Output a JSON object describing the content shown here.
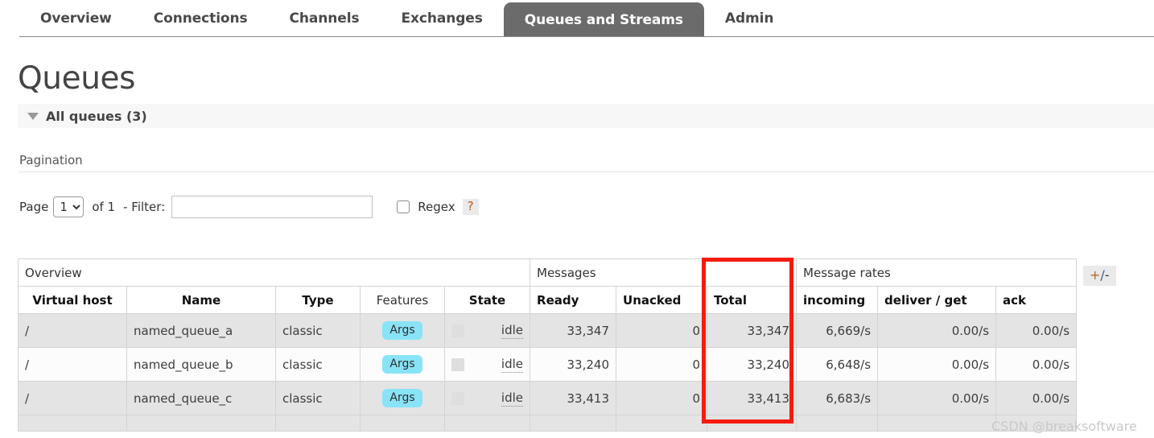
{
  "nav": {
    "items": [
      {
        "label": "Overview",
        "active": false
      },
      {
        "label": "Connections",
        "active": false
      },
      {
        "label": "Channels",
        "active": false
      },
      {
        "label": "Exchanges",
        "active": false
      },
      {
        "label": "Queues and Streams",
        "active": true
      },
      {
        "label": "Admin",
        "active": false
      }
    ]
  },
  "page": {
    "title": "Queues",
    "section_title": "All queues (3)"
  },
  "pagination": {
    "heading": "Pagination",
    "page_label": "Page",
    "page_value": "1",
    "page_options": [
      "1"
    ],
    "of_label": "of 1",
    "filter_label": "- Filter:",
    "filter_value": "",
    "filter_placeholder": "",
    "regex_label": "Regex",
    "regex_checked": false,
    "help_label": "?"
  },
  "table": {
    "group_headers": {
      "overview": "Overview",
      "messages": "Messages",
      "message_rates": "Message rates"
    },
    "columns": [
      {
        "key": "vhost",
        "label": "Virtual host",
        "bold": true
      },
      {
        "key": "name",
        "label": "Name",
        "bold": true
      },
      {
        "key": "type",
        "label": "Type",
        "bold": true
      },
      {
        "key": "features",
        "label": "Features",
        "bold": false
      },
      {
        "key": "state",
        "label": "State",
        "bold": true
      },
      {
        "key": "ready",
        "label": "Ready",
        "bold": true
      },
      {
        "key": "unacked",
        "label": "Unacked",
        "bold": true
      },
      {
        "key": "total",
        "label": "Total",
        "bold": true
      },
      {
        "key": "incoming",
        "label": "incoming",
        "bold": true
      },
      {
        "key": "deliver_get",
        "label": "deliver / get",
        "bold": true
      },
      {
        "key": "ack",
        "label": "ack",
        "bold": true
      }
    ],
    "rows": [
      {
        "vhost": "/",
        "name": "named_queue_a",
        "type": "classic",
        "features": "Args",
        "state": "idle",
        "ready": "33,347",
        "unacked": "0",
        "total": "33,347",
        "incoming": "6,669/s",
        "deliver_get": "0.00/s",
        "ack": "0.00/s"
      },
      {
        "vhost": "/",
        "name": "named_queue_b",
        "type": "classic",
        "features": "Args",
        "state": "idle",
        "ready": "33,240",
        "unacked": "0",
        "total": "33,240",
        "incoming": "6,648/s",
        "deliver_get": "0.00/s",
        "ack": "0.00/s"
      },
      {
        "vhost": "/",
        "name": "named_queue_c",
        "type": "classic",
        "features": "Args",
        "state": "idle",
        "ready": "33,413",
        "unacked": "0",
        "total": "33,413",
        "incoming": "6,683/s",
        "deliver_get": "0.00/s",
        "ack": "0.00/s"
      }
    ],
    "toggle_columns_label": "+/-"
  },
  "annotation": {
    "highlight_color": "#f51b0e",
    "highlights_column": "Total"
  },
  "watermark": "CSDN @breaksoftware"
}
